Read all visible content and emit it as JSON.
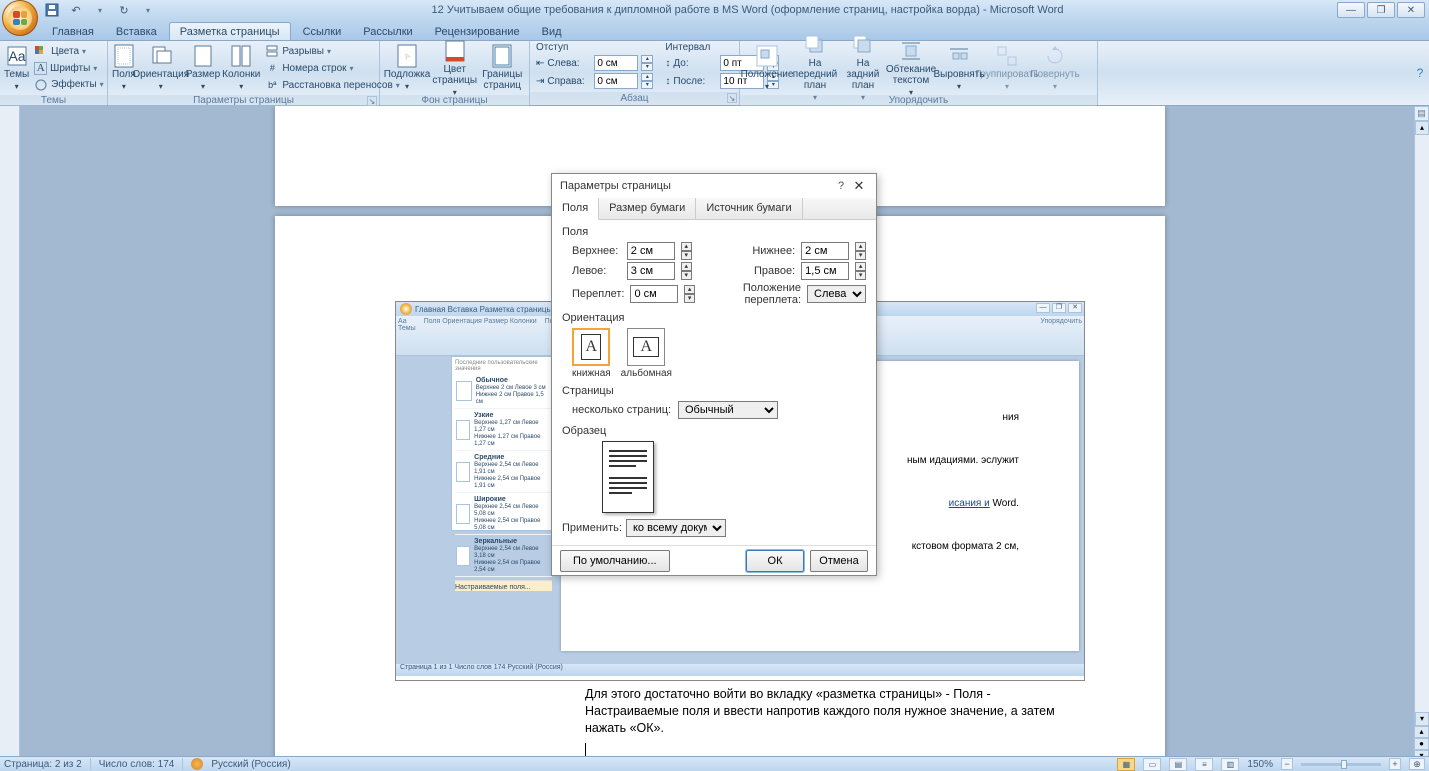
{
  "title": "12 Учитываем общие требования к дипломной работе в MS Word (оформление страниц, настройка ворда) - Microsoft Word",
  "qat": {
    "save": "save-icon",
    "undo": "↶",
    "redo": "↻"
  },
  "tabs": [
    "Главная",
    "Вставка",
    "Разметка страницы",
    "Ссылки",
    "Рассылки",
    "Рецензирование",
    "Вид"
  ],
  "active_tab": 2,
  "ribbon": {
    "themes": {
      "label": "Темы",
      "big": "Темы",
      "colors": "Цвета",
      "fonts": "Шрифты",
      "effects": "Эффекты"
    },
    "page_setup": {
      "label": "Параметры страницы",
      "margins": "Поля",
      "orientation": "Ориентация",
      "size": "Размер",
      "columns": "Колонки",
      "breaks": "Разрывы",
      "line_numbers": "Номера строк",
      "hyphenation": "Расстановка переносов"
    },
    "page_bg": {
      "label": "Фон страницы",
      "watermark": "Подложка",
      "page_color": "Цвет страницы",
      "borders": "Границы страниц"
    },
    "indent": {
      "label": "Отступ",
      "left_lbl": "Слева:",
      "left_val": "0 см",
      "right_lbl": "Справа:",
      "right_val": "0 см"
    },
    "spacing": {
      "label": "Интервал",
      "before_lbl": "До:",
      "before_val": "0 пт",
      "after_lbl": "После:",
      "after_val": "10 пт"
    },
    "paragraph_label": "Абзац",
    "arrange": {
      "label": "Упорядочить",
      "position": "Положение",
      "bring_fwd": "На передний план",
      "send_back": "На задний план",
      "wrap": "Обтекание текстом",
      "align": "Выровнять",
      "group": "Группировать",
      "rotate": "Повернуть"
    }
  },
  "dialog": {
    "title": "Параметры страницы",
    "tabs": [
      "Поля",
      "Размер бумаги",
      "Источник бумаги"
    ],
    "active_tab": 0,
    "fields_section": "Поля",
    "top_lbl": "Верхнее:",
    "top_val": "2 см",
    "bottom_lbl": "Нижнее:",
    "bottom_val": "2 см",
    "left_lbl": "Левое:",
    "left_val": "3 см",
    "right_lbl": "Правое:",
    "right_val": "1,5 см",
    "gutter_lbl": "Переплет:",
    "gutter_val": "0 см",
    "gutter_pos_lbl": "Положение переплета:",
    "gutter_pos_val": "Слева",
    "orient_section": "Ориентация",
    "orient_portrait": "книжная",
    "orient_landscape": "альбомная",
    "pages_section": "Страницы",
    "multi_pages_lbl": "несколько страниц:",
    "multi_pages_val": "Обычный",
    "preview_section": "Образец",
    "apply_lbl": "Применить:",
    "apply_val": "ко всему документу",
    "default_btn": "По умолчанию...",
    "ok_btn": "ОК",
    "cancel_btn": "Отмена"
  },
  "embed_dropdown": {
    "header": "Последние пользовательские значения",
    "items": [
      {
        "name": "Обычное",
        "t": "2 см",
        "l": "3 см",
        "b": "2 см",
        "r": "1,5 см"
      },
      {
        "name": "Узкие",
        "t": "1,27 см",
        "l": "1,27 см",
        "b": "1,27 см",
        "r": "1,27 см"
      },
      {
        "name": "Средние",
        "t": "2,54 см",
        "l": "1,91 см",
        "b": "2,54 см",
        "r": "1,91 см"
      },
      {
        "name": "Широкие",
        "t": "2,54 см",
        "l": "5,08 см",
        "b": "2,54 см",
        "r": "5,08 см"
      },
      {
        "name": "Зеркальные",
        "t": "2,54 см",
        "l": "3,18 см",
        "b": "2,54 см",
        "r": "2,54 см"
      }
    ],
    "custom": "Настраиваемые поля..."
  },
  "embed_doc": {
    "frag1": "ния",
    "frag2": "ным идациями. эслужит",
    "link": "исания и",
    "after_link": "Word.",
    "frag3": "кстовом формата 2 см,"
  },
  "page2_text": "Для этого достаточно войти во вкладку «разметка страницы» - Поля - Настраиваемые поля и ввести напротив каждого поля нужное значение, а затем нажать «ОК».",
  "status": {
    "page": "Страница: 2 из 2",
    "words": "Число слов: 174",
    "lang": "Русский (Россия)",
    "zoom": "150%"
  }
}
